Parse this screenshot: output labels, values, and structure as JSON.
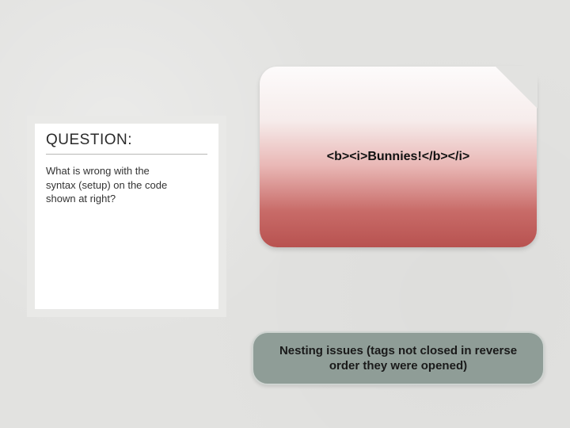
{
  "question": {
    "heading": "QUESTION:",
    "body": "What is wrong with the syntax (setup) on the code shown at right?"
  },
  "code": {
    "snippet": "<b><i>Bunnies!</b></i>"
  },
  "answer": {
    "text": "Nesting issues (tags not closed in reverse order they were opened)"
  }
}
